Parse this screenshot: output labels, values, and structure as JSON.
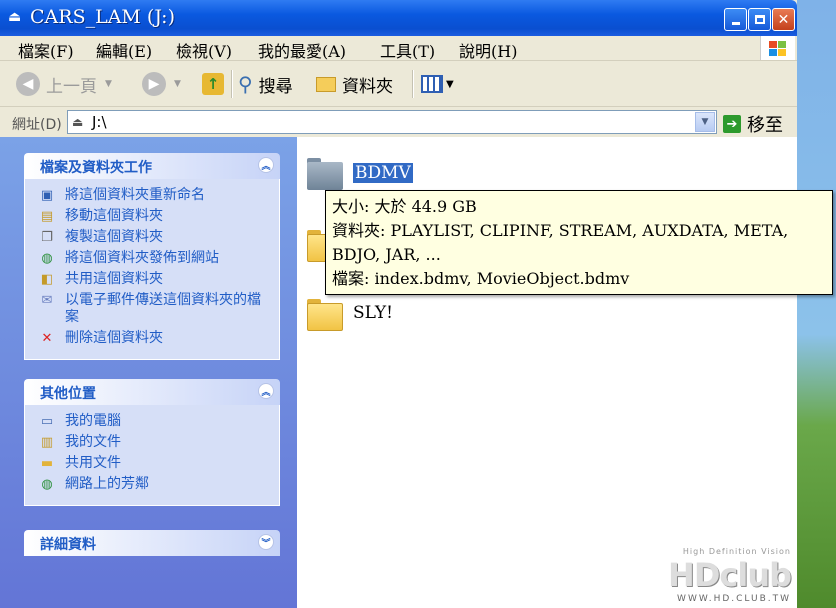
{
  "window": {
    "title": "CARS_LAM (J:)"
  },
  "menu": {
    "items": [
      "檔案(F)",
      "編輯(E)",
      "檢視(V)",
      "我的最愛(A)",
      "工具(T)",
      "說明(H)"
    ]
  },
  "toolbar": {
    "back_label": "上一頁",
    "search_label": "搜尋",
    "folders_label": "資料夾"
  },
  "address": {
    "label": "網址(D)",
    "value": "J:\\",
    "go_label": "移至"
  },
  "tasks_panel": {
    "title": "檔案及資料夾工作",
    "items": [
      {
        "label": "將這個資料夾重新命名",
        "icon": "rename-icon"
      },
      {
        "label": "移動這個資料夾",
        "icon": "move-icon"
      },
      {
        "label": "複製這個資料夾",
        "icon": "copy-icon"
      },
      {
        "label": "將這個資料夾發佈到網站",
        "icon": "globe-icon"
      },
      {
        "label": "共用這個資料夾",
        "icon": "share-icon"
      },
      {
        "label": "以電子郵件傳送這個資料夾的檔案",
        "icon": "email-icon"
      },
      {
        "label": "刪除這個資料夾",
        "icon": "delete-icon"
      }
    ]
  },
  "places_panel": {
    "title": "其他位置",
    "items": [
      {
        "label": "我的電腦",
        "icon": "computer-icon"
      },
      {
        "label": "我的文件",
        "icon": "documents-icon"
      },
      {
        "label": "共用文件",
        "icon": "shared-folder-icon"
      },
      {
        "label": "網路上的芳鄰",
        "icon": "network-icon"
      }
    ]
  },
  "details_panel": {
    "title": "詳細資料"
  },
  "files": [
    {
      "name": "BDMV",
      "selected": true
    },
    {
      "name": "",
      "selected": false
    },
    {
      "name": "SLY!",
      "selected": false
    }
  ],
  "tooltip": {
    "line1": "大小: 大於 44.9 GB",
    "line2": "資料夾: PLAYLIST, CLIPINF, STREAM, AUXDATA, META,",
    "line3": "BDJO, JAR, ...",
    "line4": "檔案: index.bdmv, MovieObject.bdmv"
  },
  "watermark": {
    "tagline": "High Definition Vision",
    "logo": "HDclub",
    "url": "WWW.HD.CLUB.TW"
  }
}
